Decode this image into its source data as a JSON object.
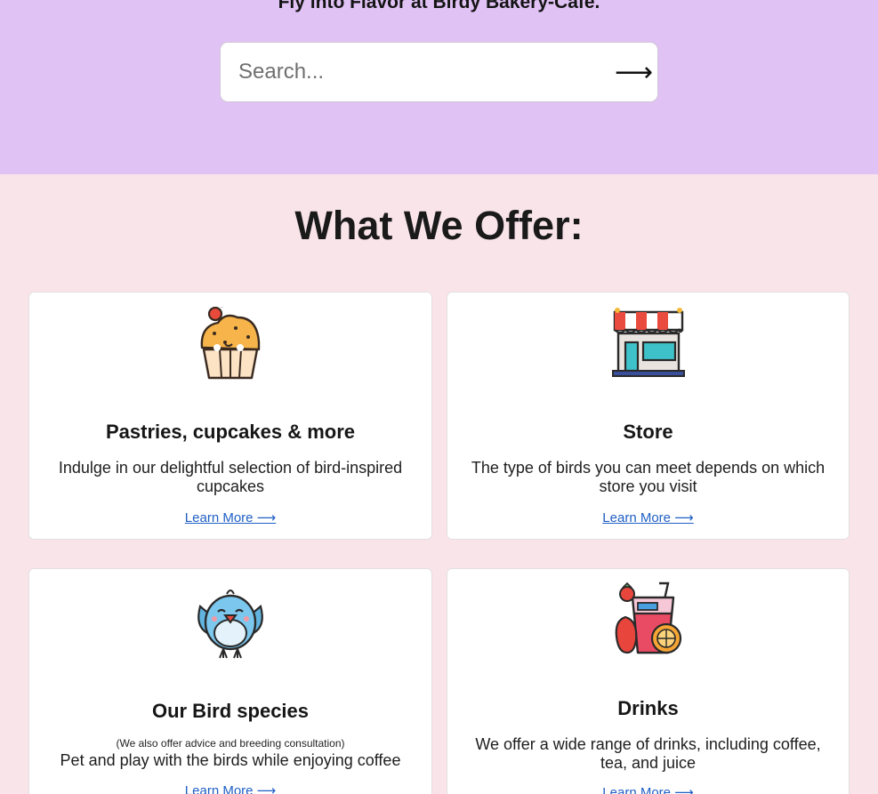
{
  "hero": {
    "title": "Fly into Flavor at Birdy Bakery-Cafe.",
    "search_placeholder": "Search...",
    "search_button": "⟶"
  },
  "offers": {
    "heading": "What We Offer:",
    "cards": [
      {
        "icon": "cupcake-icon",
        "title": "Pastries, cupcakes & more",
        "description": "Indulge in our delightful selection of bird-inspired cupcakes",
        "link": "Learn More ⟶"
      },
      {
        "icon": "store-icon",
        "title": "Store",
        "description": "The type of birds you can meet depends on which store you visit",
        "link": "Learn More ⟶"
      },
      {
        "icon": "bird-icon",
        "title": "Our Bird species",
        "note": "(We also offer advice and breeding consultation)",
        "description": "Pet and play with the birds while enjoying coffee",
        "link": "Learn More ⟶"
      },
      {
        "icon": "drinks-icon",
        "title": "Drinks",
        "description": "We offer a wide range of drinks, including coffee, tea, and juice",
        "link": "Learn More ⟶"
      }
    ]
  },
  "colors": {
    "hero_bg": "#e1c2f5",
    "page_bg": "#f9e4ea",
    "card_bg": "#ffffff",
    "link": "#1f5fc4"
  }
}
